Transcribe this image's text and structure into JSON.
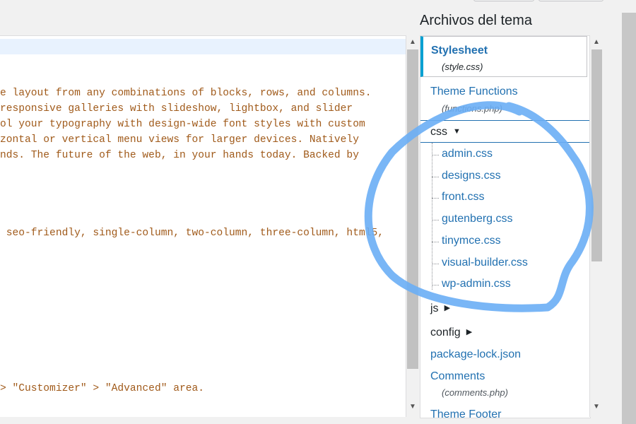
{
  "sidebar": {
    "title": "Archivos del tema",
    "active_file": {
      "label": "Stylesheet",
      "file": "(style.css)"
    },
    "items_top": [
      {
        "label": "Theme Functions",
        "file": "(functions.php)"
      }
    ],
    "css_folder": {
      "label": "css",
      "children": [
        "admin.css",
        "designs.css",
        "front.css",
        "gutenberg.css",
        "tinymce.css",
        "visual-builder.css",
        "wp-admin.css"
      ]
    },
    "js_folder": "js",
    "config_folder": "config",
    "package_file": "package-lock.json",
    "comments": {
      "label": "Comments",
      "file": "(comments.php)"
    },
    "theme_footer": "Theme Footer"
  },
  "editor": {
    "lines": [
      "e layout from any combinations of blocks, rows, and columns.",
      "responsive galleries with slideshow, lightbox, and slider",
      "ol your typography with design-wide font styles with custom",
      "zontal or vertical menu views for larger devices. Natively",
      "nds. The future of the web, in your hands today. Backed by"
    ],
    "tags_line": " seo-friendly, single-column, two-column, three-column, html5,",
    "customizer_line": "> \"Customizer\" > \"Advanced\" area."
  },
  "annotation": {
    "color": "#6aaef5"
  }
}
